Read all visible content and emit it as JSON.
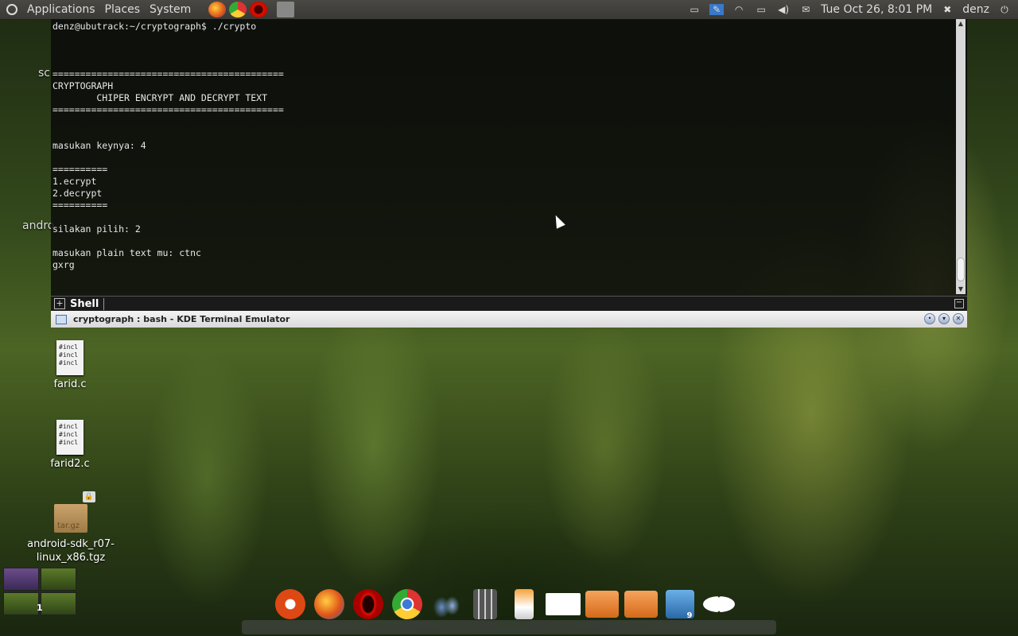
{
  "top_panel": {
    "menus": [
      "Applications",
      "Places",
      "System"
    ],
    "clock": "Tue Oct 26,  8:01 PM",
    "user": "denz"
  },
  "terminal": {
    "output_lines": [
      "denz@ubutrack:~/cryptograph$ ./crypto",
      "",
      "",
      "",
      "==========================================",
      "CRYPTOGRAPH",
      "        CHIPER ENCRYPT AND DECRYPT TEXT",
      "==========================================",
      "",
      "",
      "masukan keynya: 4",
      "",
      "==========",
      "1.ecrypt",
      "2.decrypt",
      "==========",
      "",
      "silakan pilih: 2",
      "",
      "masukan plain text mu: ctnc",
      "gxrg"
    ],
    "tab_label": "Shell",
    "window_title": "cryptograph : bash - KDE Terminal Emulator"
  },
  "desktop": {
    "partial_labels": [
      "sc",
      "andro"
    ],
    "icons": [
      {
        "label": "farid.c",
        "content_lines": [
          "#incl",
          "#incl",
          "#incl"
        ]
      },
      {
        "label": "farid2.c",
        "content_lines": [
          "#incl",
          "#incl",
          "#incl"
        ]
      },
      {
        "label": "android-sdk_r07-linux_x86.tgz",
        "badge": "tar.gz"
      }
    ]
  },
  "workspace": {
    "active_number": "1"
  },
  "dock": {
    "items": [
      "ubuntu",
      "firefox",
      "opera",
      "chrome",
      "pidgin",
      "calculator",
      "cleaner",
      "image-viewer",
      "files",
      "downloads",
      "trash",
      "xeyes"
    ],
    "trash_count": "9"
  },
  "colors": {
    "terminal_bg": "#0a0a0a",
    "titlebar": "#e4e4e4",
    "panel": "#3f3e3a"
  }
}
